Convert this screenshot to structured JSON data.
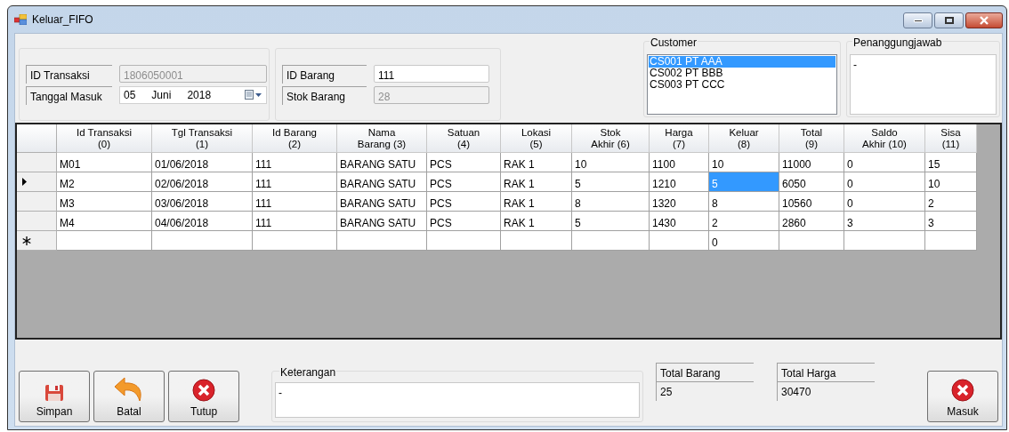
{
  "window": {
    "title": "Keluar_FIFO"
  },
  "transaksi": {
    "fields": [
      {
        "label": "ID Transaksi",
        "value": "1806050001",
        "disabled": true
      },
      {
        "label": "Tanggal Masuk",
        "kind": "date",
        "day": "05",
        "month": "Juni",
        "year": "2018"
      }
    ]
  },
  "barang": {
    "fields": [
      {
        "label": "ID Barang",
        "value": "111",
        "disabled": false
      },
      {
        "label": "Stok Barang",
        "value": "28",
        "disabled": true
      }
    ]
  },
  "customer": {
    "title": "Customer",
    "items": [
      {
        "label": "CS001 PT AAA",
        "selected": true
      },
      {
        "label": "CS002 PT BBB",
        "selected": false
      },
      {
        "label": "CS003 PT CCC",
        "selected": false
      }
    ]
  },
  "penanggungjawab": {
    "title": "Penanggungjawab",
    "value": "-"
  },
  "table": {
    "columns": [
      {
        "title": "Id Transaksi",
        "subtitle": "(0)"
      },
      {
        "title": "Tgl Transaksi",
        "subtitle": "(1)"
      },
      {
        "title": "Id Barang",
        "subtitle": "(2)"
      },
      {
        "title": "Nama",
        "subtitle": "Barang (3)"
      },
      {
        "title": "Satuan",
        "subtitle": "(4)"
      },
      {
        "title": "Lokasi",
        "subtitle": "(5)"
      },
      {
        "title": "Stok",
        "subtitle": "Akhir (6)"
      },
      {
        "title": "Harga",
        "subtitle": "(7)"
      },
      {
        "title": "Keluar",
        "subtitle": "(8)"
      },
      {
        "title": "Total",
        "subtitle": "(9)"
      },
      {
        "title": "Saldo",
        "subtitle": "Akhir (10)"
      },
      {
        "title": "Sisa",
        "subtitle": "(11)"
      }
    ],
    "rows": [
      {
        "current": false,
        "cells": [
          {
            "text": "M01",
            "selected": false
          },
          {
            "text": "01/06/2018",
            "selected": false
          },
          {
            "text": "111",
            "selected": false
          },
          {
            "text": "BARANG SATU",
            "selected": false
          },
          {
            "text": "PCS",
            "selected": false
          },
          {
            "text": "RAK 1",
            "selected": false
          },
          {
            "text": "10",
            "selected": false
          },
          {
            "text": "1100",
            "selected": false
          },
          {
            "text": "10",
            "selected": false
          },
          {
            "text": "11000",
            "selected": false
          },
          {
            "text": "0",
            "selected": false
          },
          {
            "text": "15",
            "selected": false
          }
        ]
      },
      {
        "current": true,
        "cells": [
          {
            "text": "M2",
            "selected": false
          },
          {
            "text": "02/06/2018",
            "selected": false
          },
          {
            "text": "111",
            "selected": false
          },
          {
            "text": "BARANG SATU",
            "selected": false
          },
          {
            "text": "PCS",
            "selected": false
          },
          {
            "text": "RAK 1",
            "selected": false
          },
          {
            "text": "5",
            "selected": false
          },
          {
            "text": "1210",
            "selected": false
          },
          {
            "text": "5",
            "selected": true
          },
          {
            "text": "6050",
            "selected": false
          },
          {
            "text": "0",
            "selected": false
          },
          {
            "text": "10",
            "selected": false
          }
        ]
      },
      {
        "current": false,
        "cells": [
          {
            "text": "M3",
            "selected": false
          },
          {
            "text": "03/06/2018",
            "selected": false
          },
          {
            "text": "111",
            "selected": false
          },
          {
            "text": "BARANG SATU",
            "selected": false
          },
          {
            "text": "PCS",
            "selected": false
          },
          {
            "text": "RAK 1",
            "selected": false
          },
          {
            "text": "8",
            "selected": false
          },
          {
            "text": "1320",
            "selected": false
          },
          {
            "text": "8",
            "selected": false
          },
          {
            "text": "10560",
            "selected": false
          },
          {
            "text": "0",
            "selected": false
          },
          {
            "text": "2",
            "selected": false
          }
        ]
      },
      {
        "current": false,
        "cells": [
          {
            "text": "M4",
            "selected": false
          },
          {
            "text": "04/06/2018",
            "selected": false
          },
          {
            "text": "111",
            "selected": false
          },
          {
            "text": "BARANG SATU",
            "selected": false
          },
          {
            "text": "PCS",
            "selected": false
          },
          {
            "text": "RAK 1",
            "selected": false
          },
          {
            "text": "5",
            "selected": false
          },
          {
            "text": "1430",
            "selected": false
          },
          {
            "text": "2",
            "selected": false
          },
          {
            "text": "2860",
            "selected": false
          },
          {
            "text": "3",
            "selected": false
          },
          {
            "text": "3",
            "selected": false
          }
        ]
      }
    ],
    "new_row": {
      "keluar": "0"
    }
  },
  "buttons": [
    {
      "label": "Simpan",
      "kind": "save"
    },
    {
      "label": "Batal",
      "kind": "undo"
    },
    {
      "label": "Tutup",
      "kind": "close"
    }
  ],
  "keterangan": {
    "title": "Keterangan",
    "value": "-"
  },
  "totals": [
    {
      "label": "Total Barang",
      "value": "25"
    },
    {
      "label": "Total Harga",
      "value": "30470"
    }
  ],
  "submit": {
    "label": "Masuk",
    "kind": "close"
  }
}
